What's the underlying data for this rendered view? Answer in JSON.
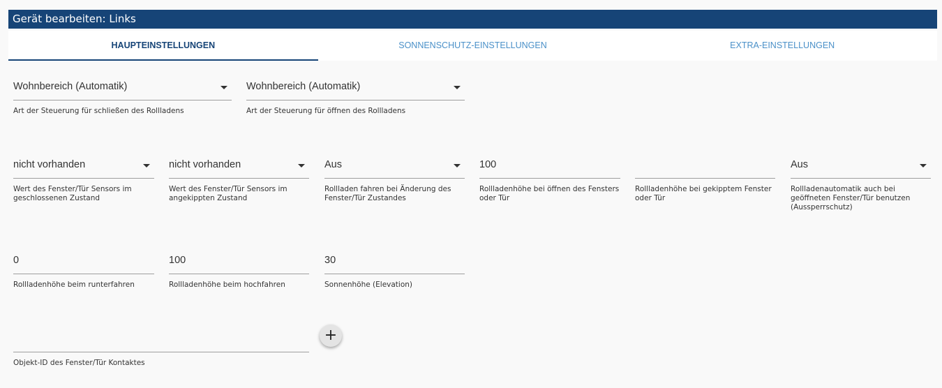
{
  "dialog": {
    "title": "Gerät bearbeiten: Links"
  },
  "tabs": [
    {
      "label": "HAUPTEINSTELLUNGEN"
    },
    {
      "label": "SONNENSCHUTZ-EINSTELLUNGEN"
    },
    {
      "label": "EXTRA-EINSTELLUNGEN"
    }
  ],
  "fields": {
    "close_type": {
      "value": "Wohnbereich (Automatik)",
      "label": "Art der Steuerung für schließen des Rollladens"
    },
    "open_type": {
      "value": "Wohnbereich (Automatik)",
      "label": "Art der Steuerung für öffnen des Rollladens"
    },
    "sensor_closed": {
      "value": "nicht vorhanden",
      "label": "Wert des Fenster/Tür Sensors im geschlossenen Zustand"
    },
    "sensor_tilted": {
      "value": "nicht vorhanden",
      "label": "Wert des Fenster/Tür Sensors im angekippten Zustand"
    },
    "move_on_change": {
      "value": "Aus",
      "label": "Rollladen fahren bei Änderung des Fenster/Tür Zustandes"
    },
    "height_open": {
      "value": "100",
      "label": "Rollladenhöhe bei öffnen des Fensters oder Tür"
    },
    "height_tilted": {
      "value": "",
      "label": "Rollladenhöhe bei gekipptem Fenster oder Tür"
    },
    "lockout": {
      "value": "Aus",
      "label": "Rollladenautomatik auch bei geöffneten Fenster/Tür benutzen (Aussperrschutz)"
    },
    "height_down": {
      "value": "0",
      "label": "Rollladenhöhe beim  runterfahren"
    },
    "height_up": {
      "value": "100",
      "label": "Rollladenhöhe beim  hochfahren"
    },
    "elevation": {
      "value": "30",
      "label": "Sonnenhöhe (Elevation)"
    },
    "contact_id": {
      "value": "",
      "label": "Objekt-ID des Fenster/Tür Kontaktes"
    }
  },
  "add_button": {
    "icon": "plus-icon",
    "symbol": "+"
  }
}
